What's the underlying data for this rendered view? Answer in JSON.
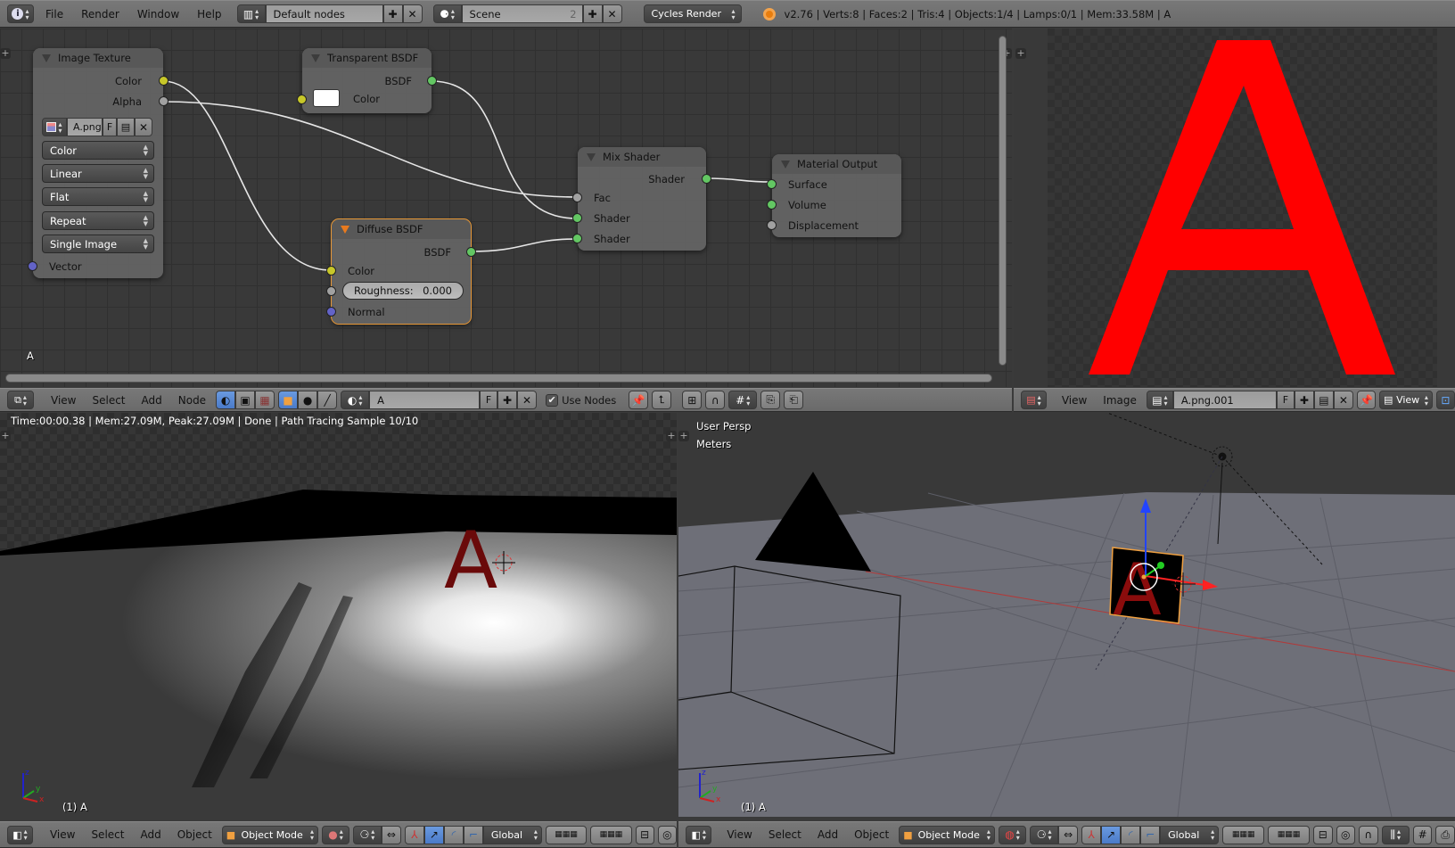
{
  "topbar": {
    "menus": [
      "File",
      "Render",
      "Window",
      "Help"
    ],
    "screen_layout": "Default nodes",
    "scene": "Scene",
    "scene_users": "2",
    "render_engine": "Cycles Render",
    "stats": "v2.76 | Verts:8 | Faces:2 | Tris:4 | Objects:1/4 | Lamps:0/1 | Mem:33.58M | A"
  },
  "node_editor": {
    "corner_label": "A",
    "nodes": {
      "image_texture": {
        "title": "Image Texture",
        "outputs": [
          "Color",
          "Alpha"
        ],
        "image_name": "A.png",
        "fake_user": "F",
        "color_space": "Color",
        "interpolation": "Linear",
        "projection": "Flat",
        "extension": "Repeat",
        "source": "Single Image",
        "input": "Vector"
      },
      "transparent_bsdf": {
        "title": "Transparent BSDF",
        "output": "BSDF",
        "input": "Color",
        "swatch_color": "#ffffff"
      },
      "diffuse_bsdf": {
        "title": "Diffuse BSDF",
        "output": "BSDF",
        "input_color": "Color",
        "roughness_label": "Roughness:",
        "roughness_value": "0.000",
        "input_normal": "Normal"
      },
      "mix_shader": {
        "title": "Mix Shader",
        "output": "Shader",
        "inputs": [
          "Fac",
          "Shader",
          "Shader"
        ]
      },
      "material_output": {
        "title": "Material Output",
        "inputs": [
          "Surface",
          "Volume",
          "Displacement"
        ]
      }
    },
    "header": {
      "menus": [
        "View",
        "Select",
        "Add",
        "Node"
      ],
      "material_name": "A",
      "fake_user": "F",
      "use_nodes_label": "Use Nodes",
      "use_nodes_checked": true
    },
    "socket_colors": {
      "color": "#c7c729",
      "shader": "#63c763",
      "float": "#a1a1a1",
      "vector": "#6363c7"
    }
  },
  "image_editor": {
    "displayed_glyph": "A",
    "glyph_color": "#ff0000",
    "header": {
      "menus": [
        "View",
        "Image"
      ],
      "image_name": "A.png.001",
      "fake_user": "F",
      "view_mode": "View"
    }
  },
  "render_view": {
    "status": "Time:00:00.38 | Mem:27.09M, Peak:27.09M | Done | Path Tracing Sample 10/10",
    "object_label": "(1) A",
    "header": {
      "menus": [
        "View",
        "Select",
        "Add",
        "Object"
      ],
      "mode": "Object Mode",
      "orientation": "Global"
    }
  },
  "viewport_3d": {
    "view_name": "User Persp",
    "units": "Meters",
    "object_label": "(1) A",
    "header": {
      "menus": [
        "View",
        "Select",
        "Add",
        "Object"
      ],
      "mode": "Object Mode",
      "orientation": "Global"
    }
  },
  "axes": {
    "x": "x",
    "y": "y",
    "z": "z"
  }
}
